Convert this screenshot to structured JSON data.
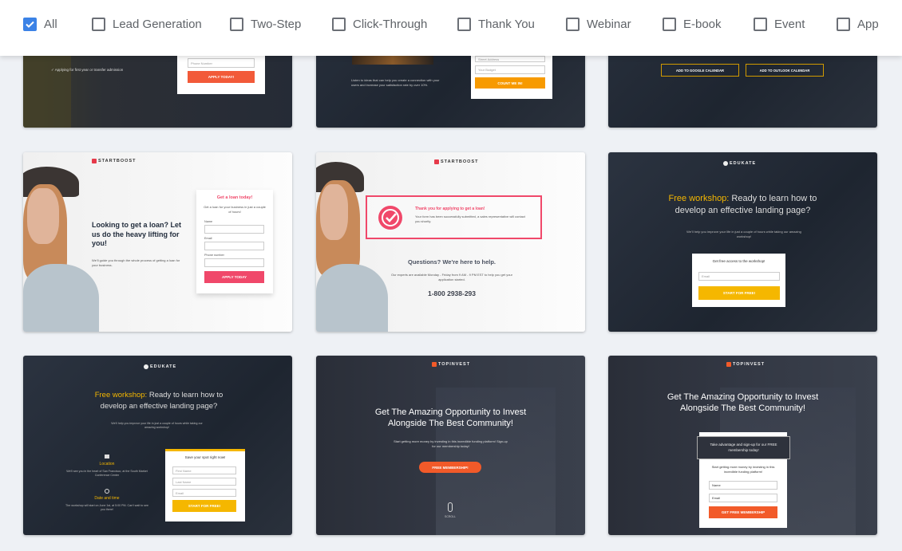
{
  "filters": [
    {
      "label": "All",
      "checked": true
    },
    {
      "label": "Lead Generation",
      "checked": false
    },
    {
      "label": "Two-Step",
      "checked": false
    },
    {
      "label": "Click-Through",
      "checked": false
    },
    {
      "label": "Thank You",
      "checked": false
    },
    {
      "label": "Webinar",
      "checked": false
    },
    {
      "label": "E-book",
      "checked": false
    },
    {
      "label": "Event",
      "checked": false
    },
    {
      "label": "App",
      "checked": false
    }
  ],
  "colors": {
    "accent": "#3b82e6",
    "startboost": "#f0486a",
    "edukate": "#f5b700",
    "topinvest": "#f25a29",
    "orange": "#f79a00"
  },
  "cards": [
    {
      "check_text": "Applying for first year or transfer admission",
      "input": "Phone Number",
      "button": "APPLY TODAY!"
    },
    {
      "text": "Listen to ideas that can help you create a connection with your users and increase your satisfaction rate by over 10%.",
      "input1": "Street Address",
      "input2": "Your Budget",
      "button": "COUNT ME IN!"
    },
    {
      "button1": "ADD TO GOOGLE CALENDAR",
      "button2": "ADD TO OUTLOOK CALENDAR"
    },
    {
      "logo": "STARTBOOST",
      "headline": "Looking to get a loan? Let us do the heavy lifting for you!",
      "sub": "We'll guide you through the whole process of getting a loan for your business.",
      "form_title": "Get a loan today!",
      "form_sub": "Get a loan for your business in just a couple of hours!",
      "l1": "Name",
      "l2": "Email",
      "l3": "Phone number",
      "button": "APPLY TODAY"
    },
    {
      "logo": "STARTBOOST",
      "thanks_title": "Thank you for applying to get a loan!",
      "thanks_text": "Your form has been successfully submitted, a sales representative will contact you shortly.",
      "questions": "Questions? We're here to help.",
      "experts": "Our experts are available Monday - Friday from 9 AM - 9 PM EST to help you get your application started.",
      "phone": "1-800 2938-293"
    },
    {
      "logo": "EDUKATE",
      "highlight": "Free workshop:",
      "headline": " Ready to learn how to develop an effective landing page?",
      "sub": "We'll help you improve your life in just a couple of hours while taking our amazing workshop!",
      "form_title": "Get free access to the workshop!",
      "input": "Email",
      "button": "START FOR FREE!"
    },
    {
      "logo": "EDUKATE",
      "highlight": "Free workshop:",
      "headline": " Ready to learn how to develop an effective landing page?",
      "sub": "We'll help you improve your life in just a couple of hours while taking our amazing workshop!",
      "loc_title": "Location",
      "loc_text": "We'll see you in the heart of San Francisco, at the South Market Conference Center",
      "date_title": "Date and time",
      "date_text": "The workshop will start on June 1st, at 5:00 PM. Can't wait to see you there!",
      "form_title": "Save your spot right now!",
      "i1": "First Name",
      "i2": "Last Name",
      "i3": "Email",
      "button": "START FOR FREE!"
    },
    {
      "logo": "TOPINVEST",
      "headline": "Get The Amazing Opportunity to Invest Alongside The Best Community!",
      "sub": "Start getting more money by investing in this incredible funding platform! Sign-up for our membership today!",
      "button": "FREE MEMBERSHIP!",
      "scroll": "SCROLL"
    },
    {
      "logo": "TOPINVEST",
      "headline": "Get The Amazing Opportunity to Invest Alongside The Best Community!",
      "box": "Take advantage and sign-up for our FREE membership today!",
      "sub": "Start getting more money by investing in this incredible funding platform!",
      "i1": "Name",
      "i2": "Email",
      "button": "GET FREE MEMBERSHIP"
    }
  ]
}
